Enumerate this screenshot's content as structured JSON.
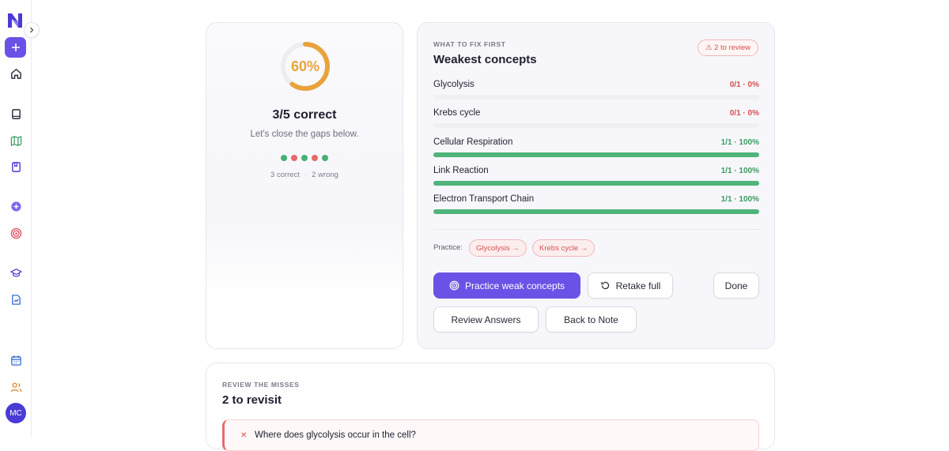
{
  "sidebar": {
    "avatar_initials": "MC",
    "accent": "#6b52e6",
    "icons": [
      "logo-icon",
      "expand-icon",
      "plus-icon",
      "home-icon",
      "book-icon",
      "map-icon",
      "bookmark-icon",
      "sparkle-icon",
      "target-icon",
      "graduation-cap-icon",
      "document-chart-icon",
      "calendar-icon",
      "users-icon"
    ]
  },
  "score": {
    "percent_label": "60%",
    "percent_value": 0.6,
    "title": "3/5 correct",
    "subtitle": "Let's close the gaps below.",
    "dots": [
      "correct",
      "wrong",
      "correct",
      "wrong",
      "correct"
    ],
    "correct_count": "3 correct",
    "separator": "·",
    "wrong_count": "2 wrong",
    "ring_color": "#e8a33d"
  },
  "weak": {
    "eyebrow": "WHAT TO FIX FIRST",
    "title": "Weakest concepts",
    "review_badge": "⚠ 2 to review",
    "concepts": [
      {
        "name": "Glycolysis",
        "stat": "0/1 · 0%",
        "fraction": 0,
        "status": "bad"
      },
      {
        "name": "Krebs cycle",
        "stat": "0/1 · 0%",
        "fraction": 0,
        "status": "bad"
      },
      {
        "name": "Cellular Respiration",
        "stat": "1/1 · 100%",
        "fraction": 1,
        "status": "good"
      },
      {
        "name": "Link Reaction",
        "stat": "1/1 · 100%",
        "fraction": 1,
        "status": "good"
      },
      {
        "name": "Electron Transport Chain",
        "stat": "1/1 · 100%",
        "fraction": 1,
        "status": "good"
      }
    ],
    "practice_label": "Practice:",
    "practice_chips": [
      "Glycolysis →",
      "Krebs cycle →"
    ],
    "buttons": {
      "practice_weak": "Practice weak concepts",
      "retake_full": "Retake full",
      "done": "Done",
      "review_answers": "Review Answers",
      "back_to_note": "Back to Note"
    },
    "good_color": "#4fb47a",
    "bad_color": "#d4514f"
  },
  "misses": {
    "eyebrow": "REVIEW THE MISSES",
    "title": "2 to revisit",
    "items": [
      {
        "mark": "✕",
        "question": "Where does glycolysis occur in the cell?"
      }
    ]
  }
}
